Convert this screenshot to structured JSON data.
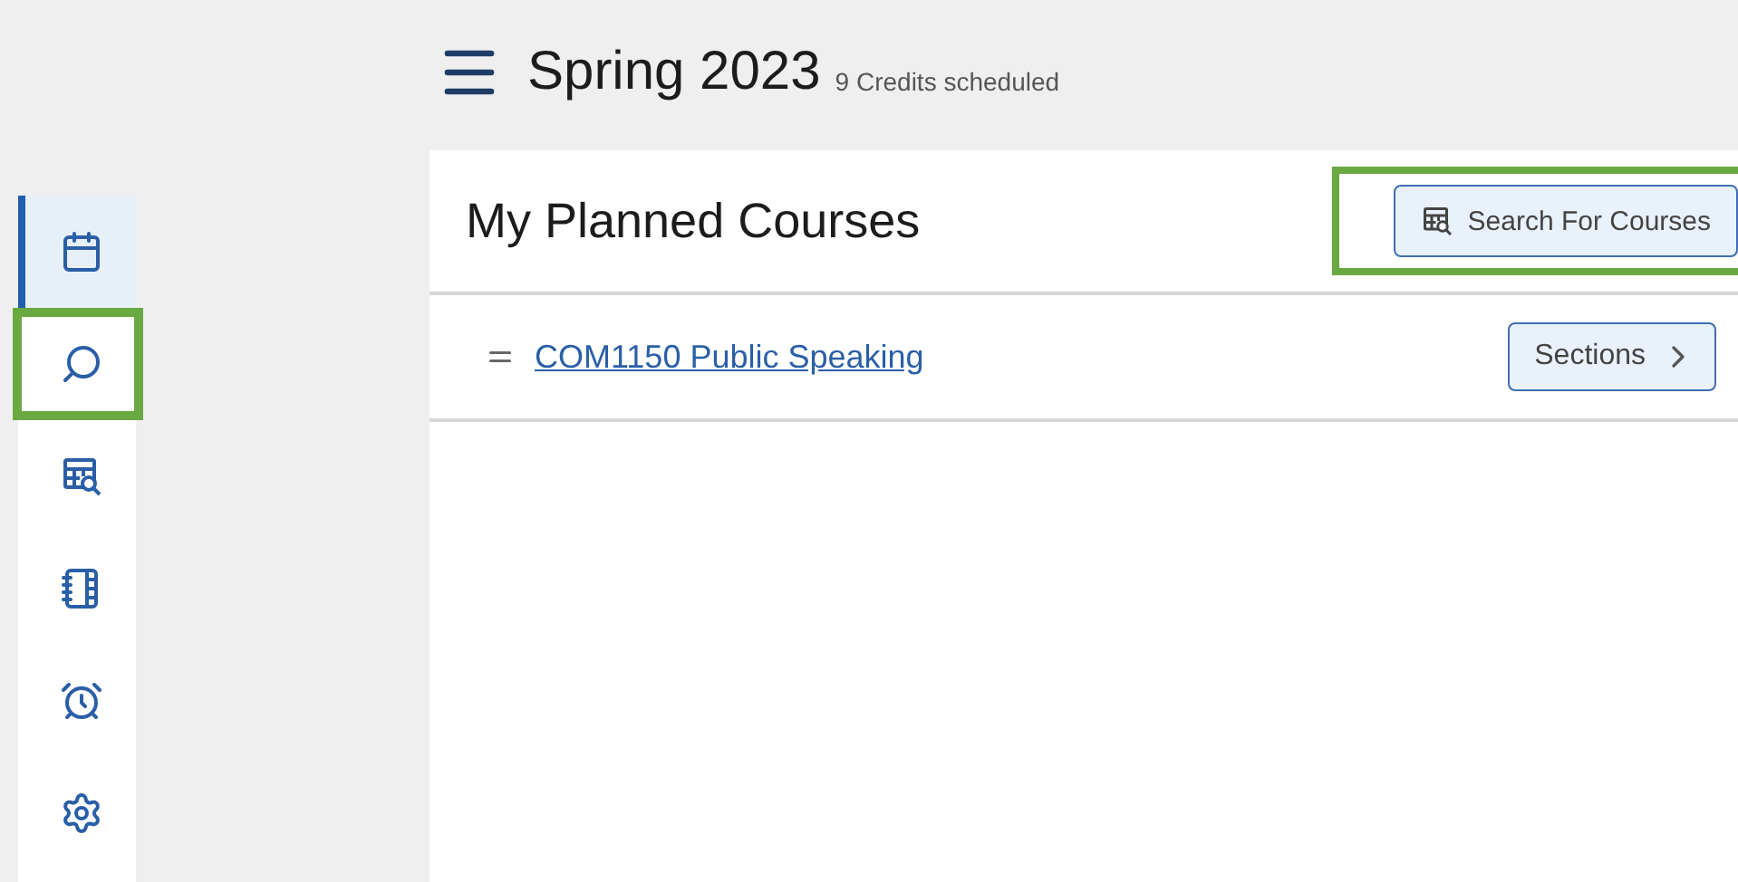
{
  "sidebar": {
    "items": [
      {
        "kind": "calendar",
        "selected": true,
        "highlighted": false
      },
      {
        "kind": "search",
        "selected": false,
        "highlighted": true
      },
      {
        "kind": "catalog",
        "selected": false,
        "highlighted": false
      },
      {
        "kind": "notebook",
        "selected": false,
        "highlighted": false
      },
      {
        "kind": "alarm",
        "selected": false,
        "highlighted": false
      },
      {
        "kind": "settings",
        "selected": false,
        "highlighted": false
      }
    ]
  },
  "header": {
    "title": "Spring 2023",
    "subtitle": "9 Credits scheduled"
  },
  "panel": {
    "title": "My Planned Courses",
    "search_button": {
      "label": "Search For Courses",
      "highlighted": true
    },
    "courses": [
      {
        "name": "COM1150 Public Speaking",
        "button": "Sections"
      }
    ]
  }
}
